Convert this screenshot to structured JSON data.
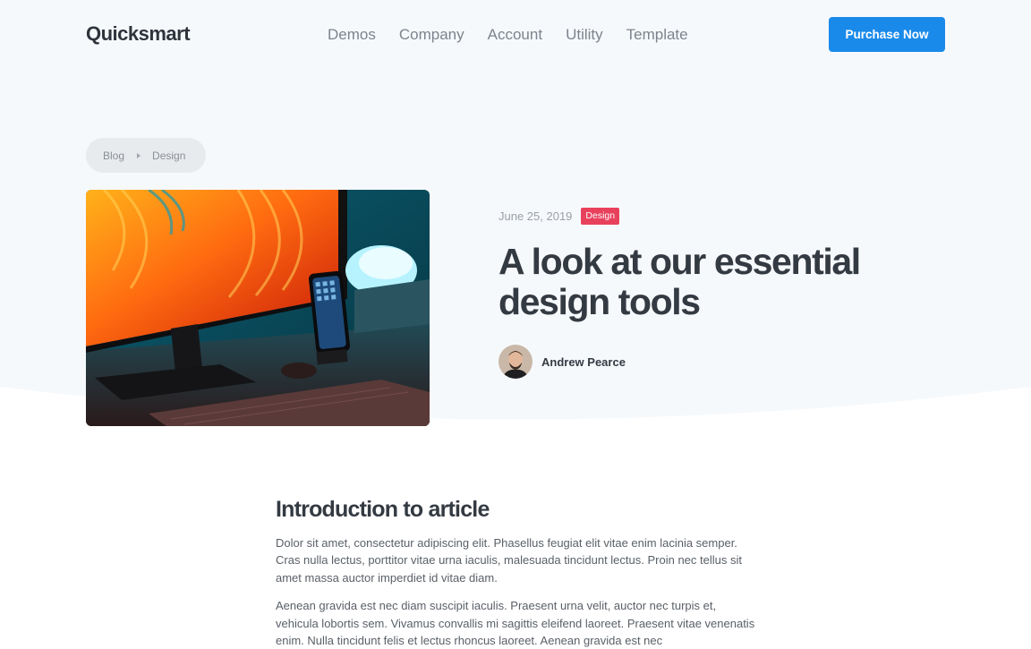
{
  "header": {
    "logo": "Quicksmart",
    "nav": [
      "Demos",
      "Company",
      "Account",
      "Utility",
      "Template"
    ],
    "cta_label": "Purchase Now"
  },
  "breadcrumb": [
    "Blog",
    "Design"
  ],
  "post": {
    "date": "June 25, 2019",
    "category": "Design",
    "title": "A look at our essential design tools",
    "author": "Andrew Pearce"
  },
  "article": {
    "heading": "Introduction to article",
    "paragraphs": [
      "Dolor sit amet, consectetur adipiscing elit. Phasellus feugiat elit vitae enim lacinia semper. Cras nulla lectus, porttitor vitae urna iaculis, malesuada tincidunt lectus. Proin nec tellus sit amet massa auctor imperdiet id vitae diam.",
      "Aenean gravida est nec diam suscipit iaculis. Praesent urna velit, auctor nec turpis et, vehicula lobortis sem. Vivamus convallis mi sagittis eleifend laoreet. Praesent vitae venenatis enim. Nulla tincidunt felis et lectus rhoncus laoreet. Aenean gravida est nec"
    ]
  },
  "colors": {
    "hero_background": "#f6f9fc",
    "primary": "#1a8aea",
    "badge": "#e8415c",
    "heading": "#343a42"
  }
}
